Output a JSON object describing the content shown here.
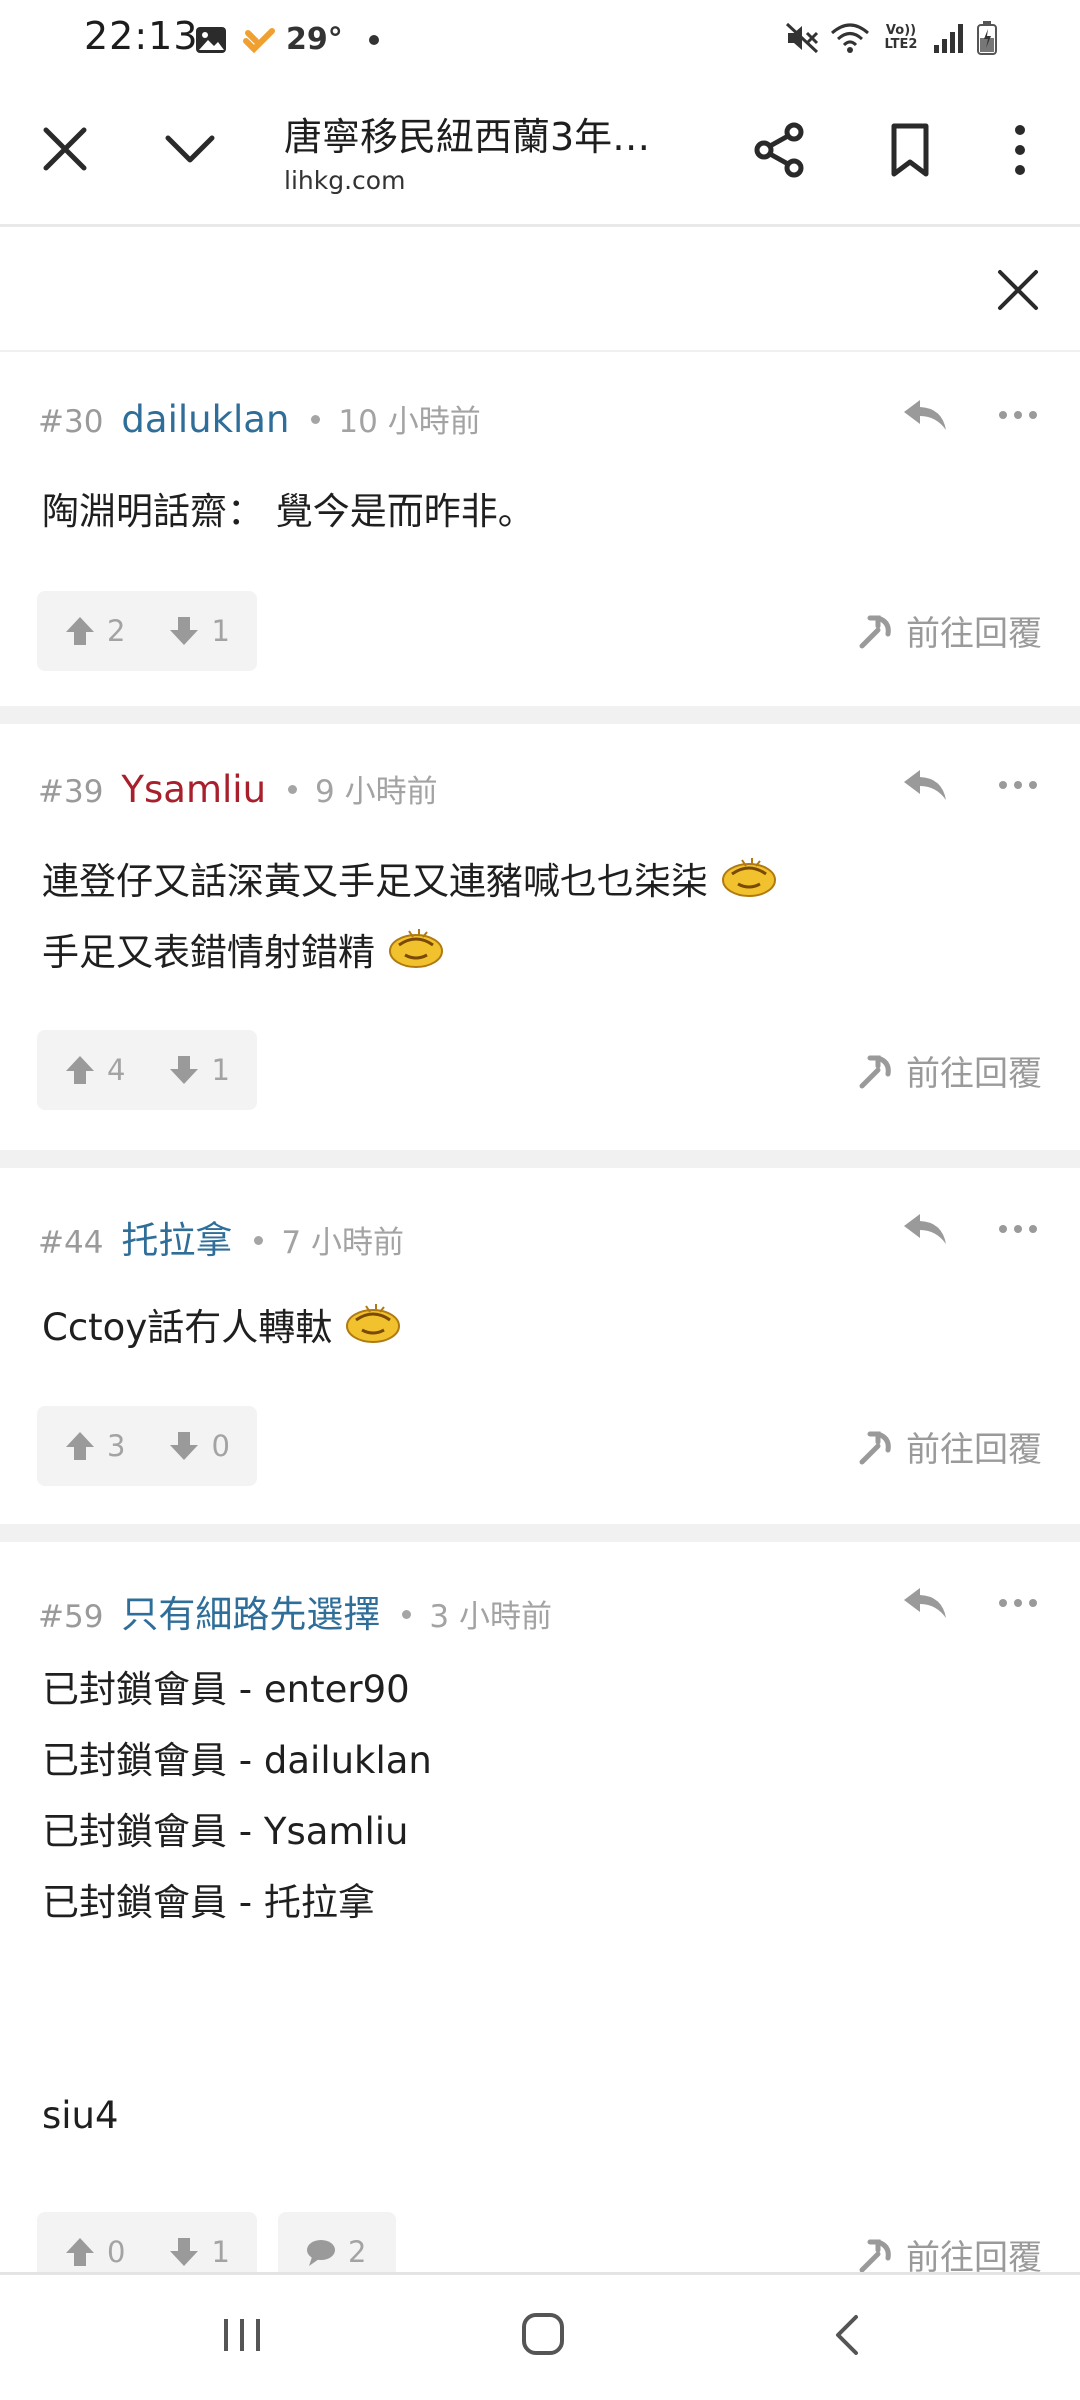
{
  "status_bar": {
    "time": "22:13",
    "temperature": "29°",
    "network": "Vo)) LTE2"
  },
  "app_bar": {
    "title": "唐寧移民紐西蘭3年…",
    "url": "lihkg.com",
    "icons": [
      "close-icon",
      "chevron-down-icon",
      "share-icon",
      "bookmark-icon",
      "more-vert-icon"
    ]
  },
  "colors": {
    "user_blue": "#2f6e99",
    "user_red": "#a8202c",
    "meta_gray": "#a3a3a3",
    "separator": "#f1f1f1"
  },
  "posts": [
    {
      "number": "#30",
      "username": "dailuklan",
      "time": "10 小時前",
      "lines": [
        "陶淵明話齋： 覺今是而昨非。"
      ],
      "upvotes": "2",
      "downvotes": "1",
      "goto_reply": "前往回覆"
    },
    {
      "number": "#39",
      "username": "Ysamliu",
      "time": "9 小時前",
      "lines": [
        "連登仔又話深黃又手足又連豬喊乜乜柒柒",
        "手足又表錯情射錯精"
      ],
      "upvotes": "4",
      "downvotes": "1",
      "goto_reply": "前往回覆"
    },
    {
      "number": "#44",
      "username": "托拉拿",
      "time": "7 小時前",
      "lines": [
        "Cctoy話冇人轉軚"
      ],
      "upvotes": "3",
      "downvotes": "0",
      "goto_reply": "前往回覆"
    },
    {
      "number": "#59",
      "username": "只有細路先選擇",
      "time": "3 小時前",
      "lines": [
        "已封鎖會員 - enter90",
        "已封鎖會員 - dailuklan",
        "已封鎖會員 - Ysamliu",
        "已封鎖會員 - 托拉拿",
        "siu4"
      ],
      "upvotes": "0",
      "downvotes": "1",
      "comments": "2",
      "goto_reply": "前往回覆"
    }
  ]
}
